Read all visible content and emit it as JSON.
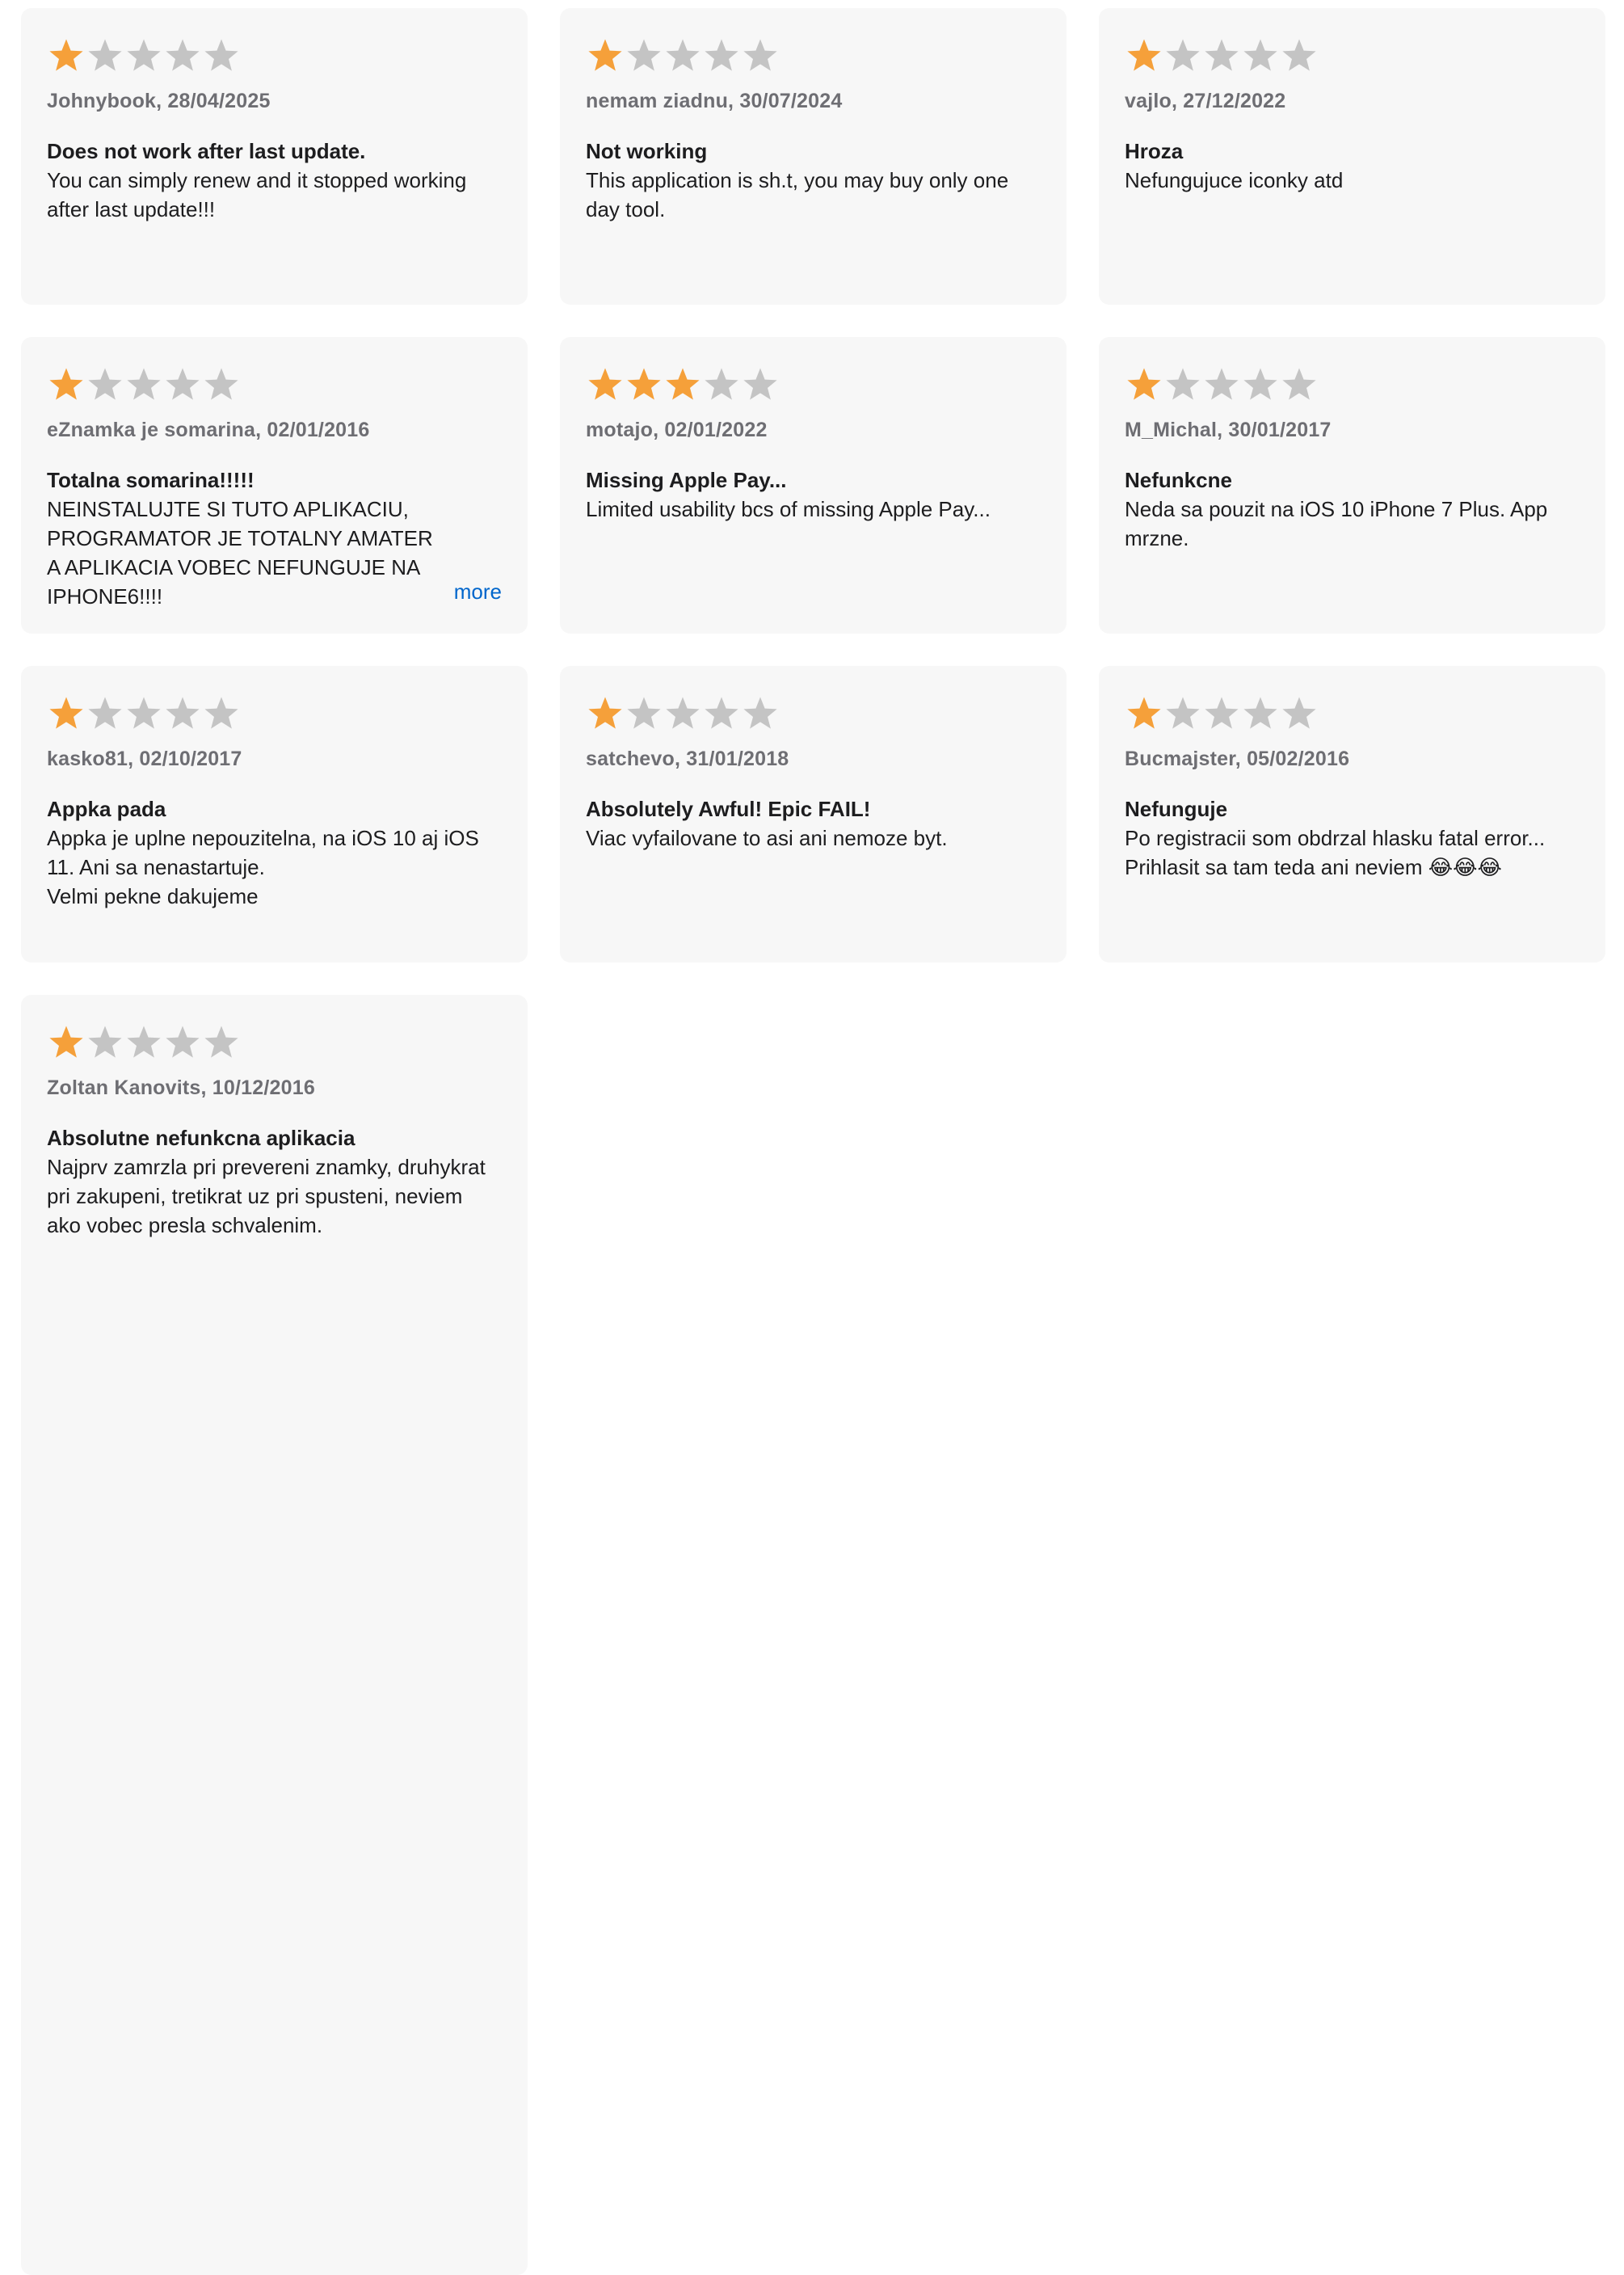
{
  "colors": {
    "star_filled": "#f5a03a",
    "star_empty": "#c4c4c4",
    "card_bg": "#f7f7f7",
    "link": "#0066cc"
  },
  "reviews": [
    {
      "rating": 1,
      "author_date": "Johnybook, 28/04/2025",
      "title": "Does not work after last update.",
      "body": "You can simply renew and it stopped working after last update!!!"
    },
    {
      "rating": 1,
      "author_date": "nemam ziadnu, 30/07/2024",
      "title": "Not working",
      "body": "This application is sh.t, you may buy only one day tool."
    },
    {
      "rating": 1,
      "author_date": "vajlo, 27/12/2022",
      "title": "Hroza",
      "body": "Nefungujuce iconky atd"
    },
    {
      "rating": 1,
      "author_date": "eZnamka je somarina, 02/01/2016",
      "title": "Totalna somarina!!!!!",
      "body": "NEINSTALUJTE SI TUTO APLIKACIU, PROGRAMATOR JE TOTALNY AMATER A APLIKACIA VOBEC NEFUNGUJE NA IPHONE6!!!!",
      "more_label": "more"
    },
    {
      "rating": 3,
      "author_date": "motajo, 02/01/2022",
      "title": "Missing Apple Pay...",
      "body": "Limited usability bcs of missing Apple Pay..."
    },
    {
      "rating": 1,
      "author_date": "M_Michal, 30/01/2017",
      "title": "Nefunkcne",
      "body": "Neda sa pouzit na iOS 10 iPhone 7 Plus. App mrzne."
    },
    {
      "rating": 1,
      "author_date": "kasko81, 02/10/2017",
      "title": "Appka pada",
      "body": "Appka je uplne nepouzitelna, na iOS 10 aj iOS 11. Ani sa nenastartuje.\nVelmi pekne dakujeme"
    },
    {
      "rating": 1,
      "author_date": "satchevo, 31/01/2018",
      "title": "Absolutely Awful! Epic FAIL!",
      "body": "Viac vyfailovane to asi ani nemoze byt."
    },
    {
      "rating": 1,
      "author_date": "Bucmajster, 05/02/2016",
      "title": "Nefunguje",
      "body": "Po registracii som obdrzal hlasku fatal error...\nPrihlasit sa tam teda ani neviem 😂😂😂"
    },
    {
      "rating": 1,
      "author_date": "Zoltan Kanovits, 10/12/2016",
      "title": "Absolutne nefunkcna aplikacia",
      "body": "Najprv zamrzla pri prevereni znamky, druhykrat pri zakupeni, tretikrat uz pri spusteni, neviem ako vobec presla schvalenim."
    }
  ]
}
